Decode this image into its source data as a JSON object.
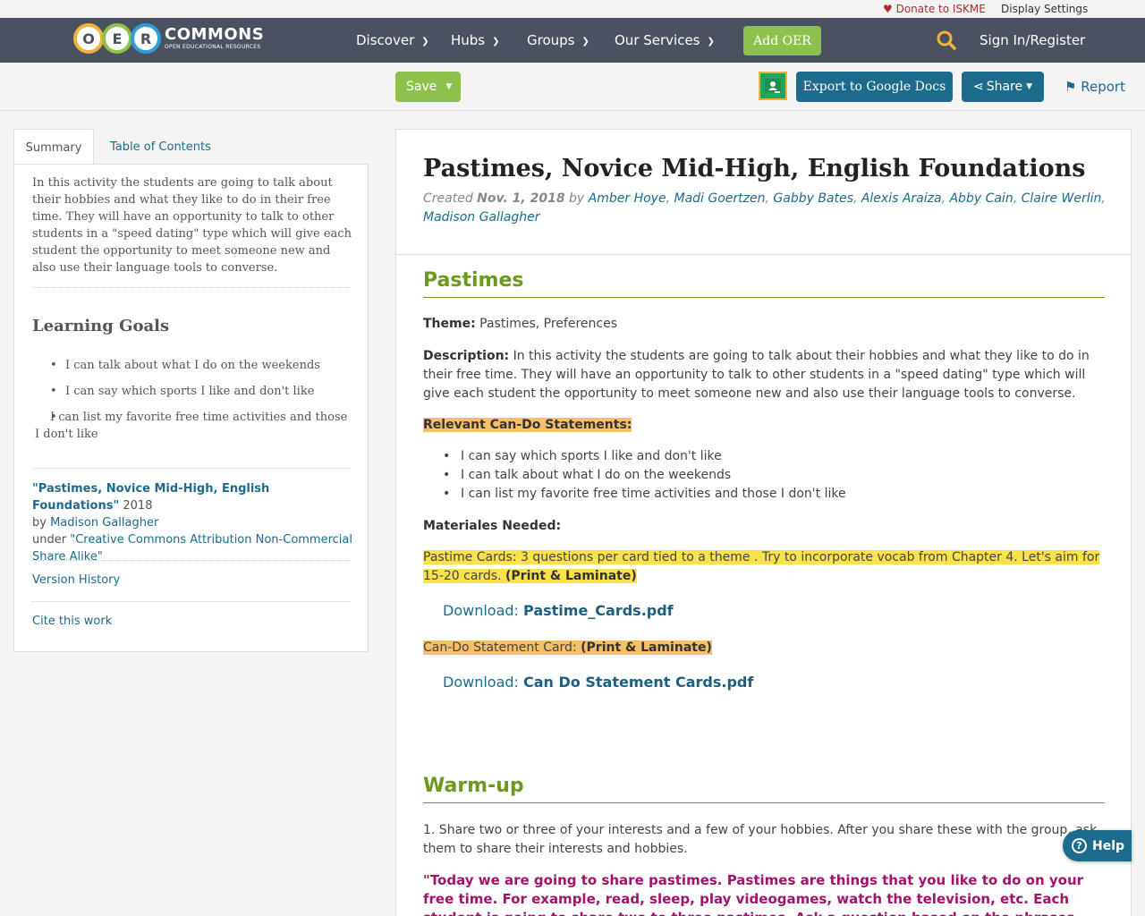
{
  "utility": {
    "donate": "Donate to ISKME",
    "display_settings": "Display Settings"
  },
  "logo": {
    "letters": [
      "O",
      "E",
      "R"
    ],
    "wordmark": "COMMONS",
    "tagline": "OPEN EDUCATIONAL RESOURCES"
  },
  "nav": {
    "items": [
      {
        "label": "Discover"
      },
      {
        "label": "Hubs"
      },
      {
        "label": "Groups"
      },
      {
        "label": "Our Services"
      }
    ],
    "add_oer": "Add OER",
    "sign_in": "Sign In/Register"
  },
  "toolbar": {
    "save": "Save",
    "export": "Export to Google Docs",
    "share": "Share",
    "report": "Report"
  },
  "sidebar": {
    "tabs": [
      {
        "label": "Summary",
        "active": true
      },
      {
        "label": "Table of Contents",
        "active": false
      }
    ],
    "description": "In this activity the students are going to talk about their hobbies and what they like to do in their free time. They will have an opportunity to talk to other students in a \"speed dating\" type which will give each student the opportunity to meet someone new and also use their language tools to converse.",
    "learning_goals_title": "Learning Goals",
    "learning_goals": [
      "I can talk about what I do on the weekends",
      "I can say which sports I like and don't like",
      "I can list my favorite free time activities and those I don't like"
    ],
    "attribution": {
      "title": "\"Pastimes, Novice Mid-High, English Foundations\"",
      "year": " 2018",
      "by": "by ",
      "author": "Madison Gallagher",
      "under": "under ",
      "license": "\"Creative Commons Attribution Non-Commercial Share Alike\""
    },
    "version_history": "Version History",
    "cite": "Cite this work"
  },
  "resource": {
    "title": "Pastimes, Novice Mid-High, English Foundations",
    "created_label": "Created ",
    "created_date": "Nov. 1, 2018",
    "by_label": " by ",
    "authors": [
      "Amber Hoye",
      "Madi Goertzen",
      "Gabby Bates",
      "Alexis Araiza",
      "Abby Cain",
      "Claire Werlin",
      "Madison Gallagher"
    ]
  },
  "section1": {
    "title": "Pastimes",
    "theme_label": "Theme:",
    "theme_value": " Pastimes, Preferences",
    "description_label": "Description:",
    "description_value": " In this activity the students are going to talk about their hobbies and what they like to do in their free time. They will have an opportunity to talk to other students in a \"speed dating\" type which will give each student the opportunity to meet someone new and also use their language tools to converse.",
    "cando_label": "Relevant Can-Do Statements:",
    "cando_items": [
      "I can say which sports I like and don't like",
      "I can talk about what I do on the weekends",
      "I can list my favorite free time activities and those I don't like"
    ],
    "materials_label": "Materiales Needed:",
    "pastime_cards_text": "Pastime Cards: 3 questions per card tied to a theme . Try to incorporate vocab from Chapter 4. Let's aim for 15-20 cards. ",
    "print_laminate": "(Print & Laminate)",
    "download_label": "Download: ",
    "pastime_cards_file": "Pastime_Cards.pdf",
    "cando_card_text": "Can-Do Statement Card: ",
    "cando_card_file": "Can Do Statement Cards.pdf"
  },
  "section2": {
    "title": "Warm-up",
    "step1": "1. Share two or three of your interests and a few of your hobbies. After you share these with the group, ask them to share their interests and hobbies.",
    "quote": "\"Today we are going to share pastimes. Pastimes are things that you like to do on your free time. For example, read, sleep, play videogames, watch the television, etc. Each student is going to share two to three pastimes. Ask a question based on the phrases above.\""
  },
  "help": "Help",
  "colors": {
    "nav_bg": "#4a5261",
    "accent_green": "#8dc14b",
    "primary_blue": "#1c6b8c",
    "section_green": "#6a9a1f",
    "quote_magenta": "#a2136b"
  }
}
